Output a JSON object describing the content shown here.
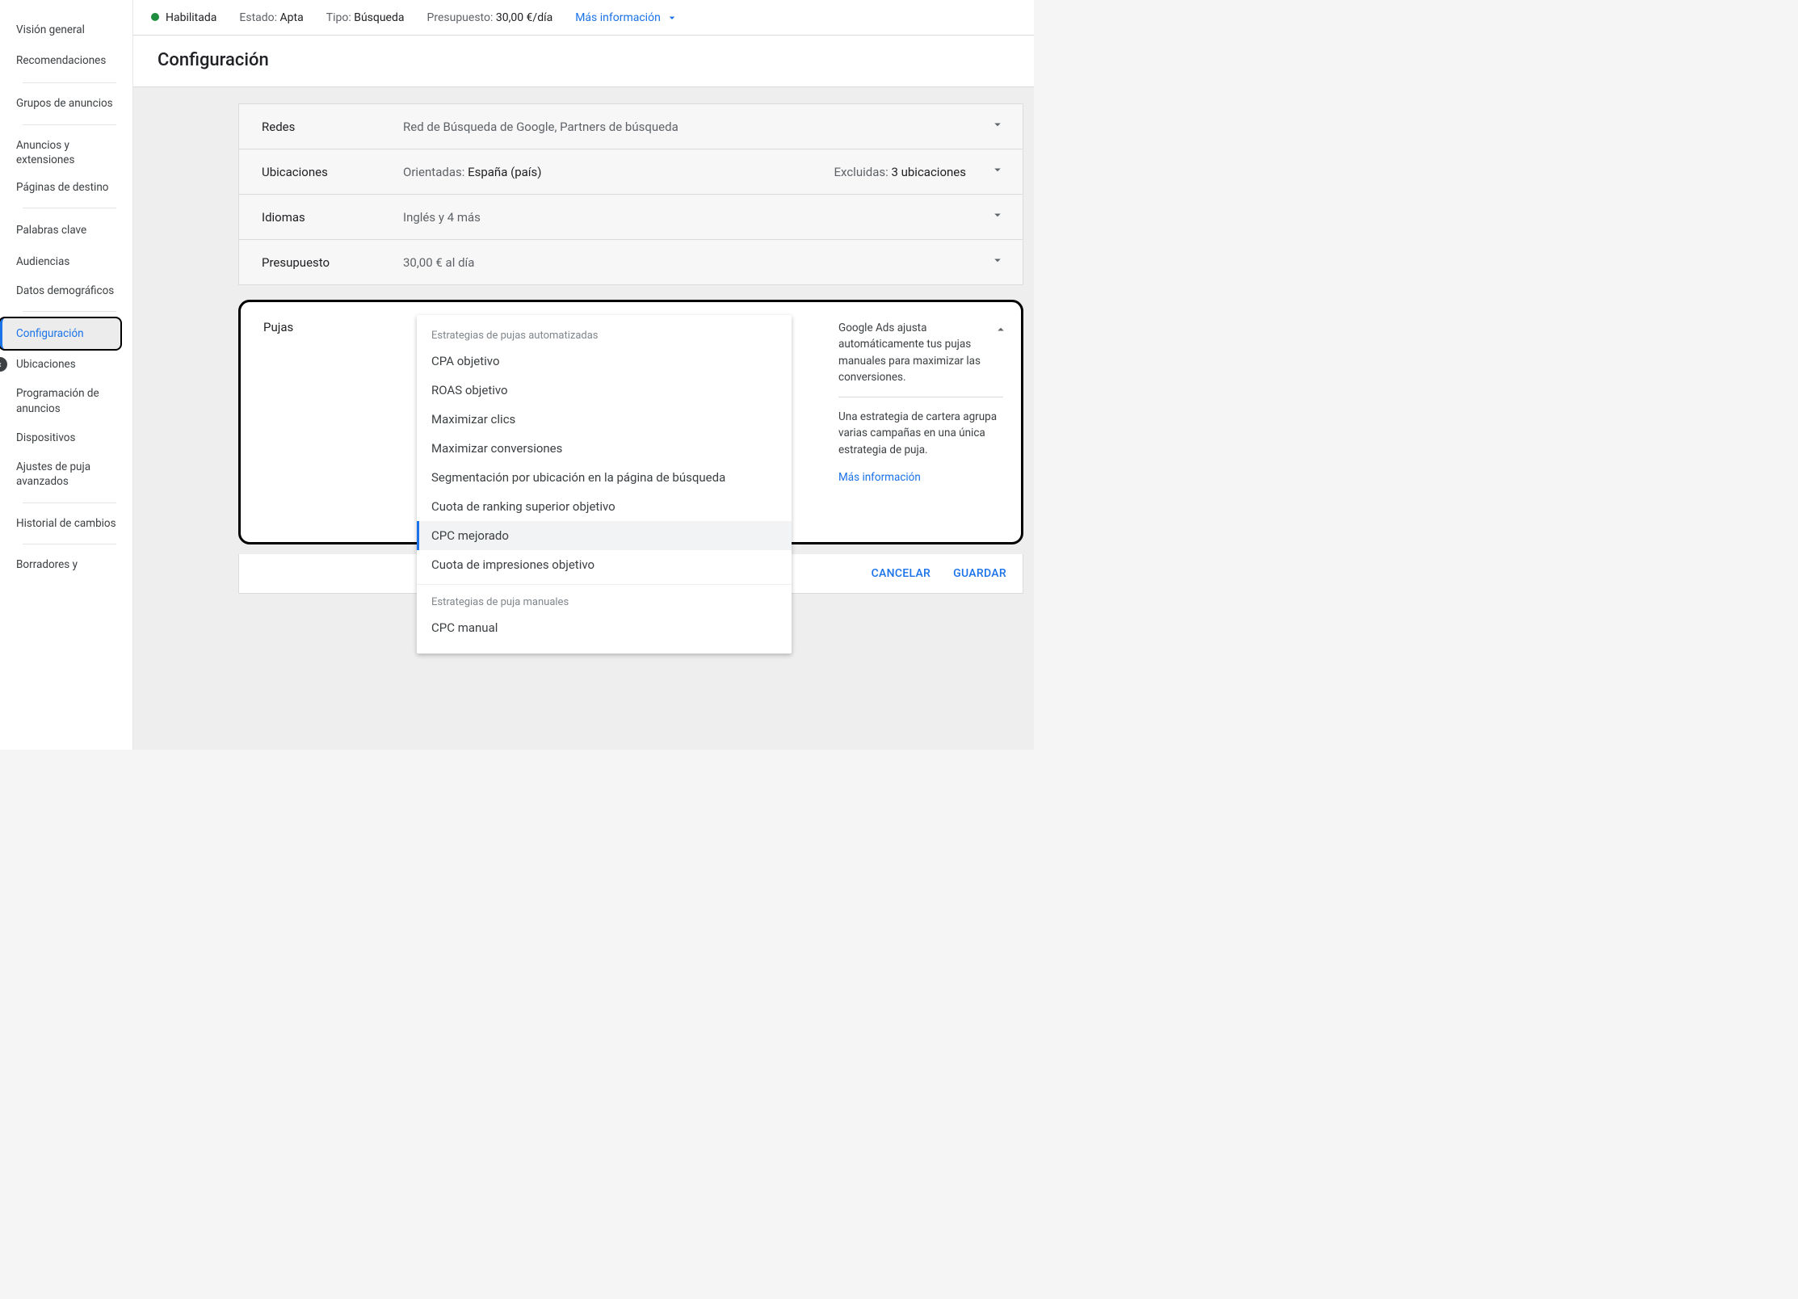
{
  "sidebar": {
    "items": [
      {
        "label": "Visión general"
      },
      {
        "label": "Recomendaciones"
      },
      {
        "label": "Grupos de anuncios"
      },
      {
        "label": "Anuncios y extensiones"
      },
      {
        "label": "Páginas de destino"
      },
      {
        "label": "Palabras clave"
      },
      {
        "label": "Audiencias"
      },
      {
        "label": "Datos demográficos"
      },
      {
        "label": "Configuración"
      },
      {
        "label": "Ubicaciones"
      },
      {
        "label": "Programación de anuncios"
      },
      {
        "label": "Dispositivos"
      },
      {
        "label": "Ajustes de puja avanzados"
      },
      {
        "label": "Historial de cambios"
      },
      {
        "label": "Borradores y"
      }
    ]
  },
  "topbar": {
    "status": "Habilitada",
    "estado_label": "Estado:",
    "estado_value": "Apta",
    "tipo_label": "Tipo:",
    "tipo_value": "Búsqueda",
    "presupuesto_label": "Presupuesto:",
    "presupuesto_value": "30,00 €/día",
    "mas_info": "Más información"
  },
  "page_title": "Configuración",
  "settings": {
    "redes": {
      "label": "Redes",
      "value": "Red de Búsqueda de Google, Partners de búsqueda"
    },
    "ubicaciones": {
      "label": "Ubicaciones",
      "orientadas_label": "Orientadas: ",
      "orientadas_value": "España (país)",
      "excluidas_label": "Excluidas: ",
      "excluidas_value": "3 ubicaciones"
    },
    "idiomas": {
      "label": "Idiomas",
      "value": "Inglés y 4 más"
    },
    "presupuesto": {
      "label": "Presupuesto",
      "value": "30,00 € al día"
    }
  },
  "pujas": {
    "label": "Pujas",
    "dropdown": {
      "header_auto": "Estrategias de pujas automatizadas",
      "header_manual": "Estrategias de puja manuales",
      "items_auto": [
        "CPA objetivo",
        "ROAS objetivo",
        "Maximizar clics",
        "Maximizar conversiones",
        "Segmentación por ubicación en la página de búsqueda",
        "Cuota de ranking superior objetivo",
        "CPC mejorado",
        "Cuota de impresiones objetivo"
      ],
      "item_manual": "CPC manual"
    },
    "info1": "Google Ads ajusta automáticamente tus pujas manuales para maximizar las conversiones.",
    "info2": "Una estrategia de cartera agrupa varias campañas en una única estrategia de puja.",
    "info_link": "Más información"
  },
  "footer": {
    "cancel": "CANCELAR",
    "save": "GUARDAR"
  }
}
